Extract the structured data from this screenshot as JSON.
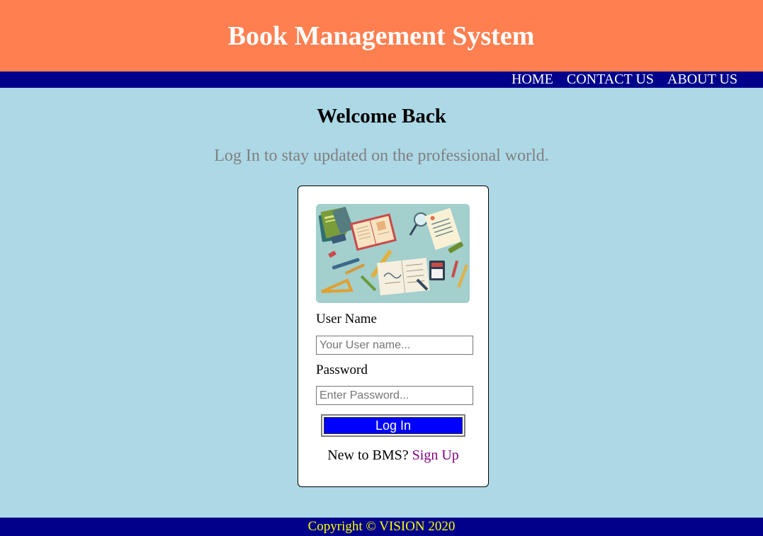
{
  "header": {
    "title": "Book Management System"
  },
  "nav": {
    "items": [
      "HOME",
      "CONTACT US",
      "ABOUT US"
    ]
  },
  "main": {
    "heading": "Welcome Back",
    "tagline": "Log In to stay updated on the professional world."
  },
  "login_form": {
    "username_label": "User Name",
    "username_placeholder": "Your User name...",
    "username_value": "",
    "password_label": "Password",
    "password_placeholder": "Enter Password...",
    "password_value": "",
    "submit_label": "Log In",
    "signup_prompt": "New to BMS?",
    "signup_link": "Sign Up"
  },
  "footer": {
    "text": "Copyright © VISION 2020"
  },
  "colors": {
    "header_bg": "#ff7f50",
    "nav_bg": "#00008b",
    "page_bg": "#add8e6",
    "button_bg": "#0000ff",
    "footer_text": "#ffff00",
    "link": "#800080"
  }
}
